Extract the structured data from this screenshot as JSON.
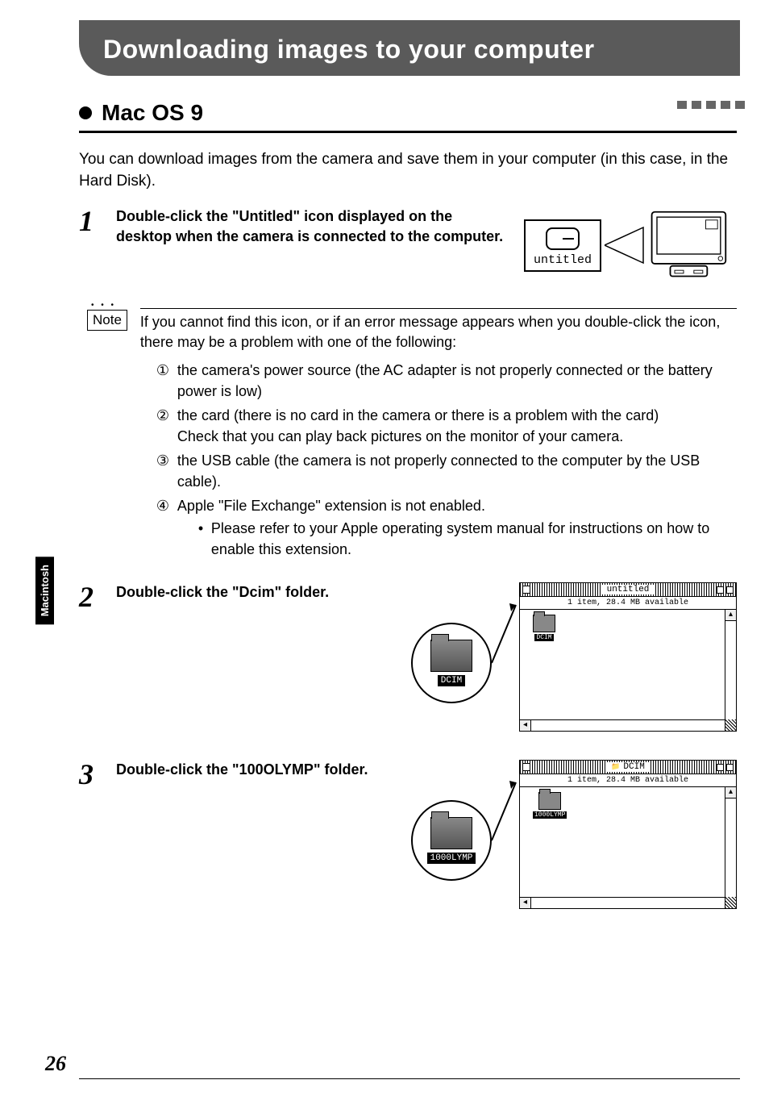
{
  "header": {
    "title": "Downloading images to your computer"
  },
  "section": {
    "title": "Mac OS 9"
  },
  "intro": "You can download images from the camera and save them in your computer (in this case, in the Hard Disk).",
  "steps": {
    "s1": {
      "num": "1",
      "text": "Double-click the \"Untitled\" icon displayed on the desktop when the camera is connected to the computer."
    },
    "s1_icon_label": "untitled",
    "s2": {
      "num": "2",
      "text": "Double-click the \"Dcim\" folder."
    },
    "s3": {
      "num": "3",
      "text": "Double-click the \"100OLYMP\" folder."
    }
  },
  "note": {
    "label": "Note",
    "lead": "If you cannot find this icon, or if an error message appears when you double-click the icon, there may be a problem with one of the following:",
    "items": {
      "i1": {
        "mark": "①",
        "text": "the camera's power source (the AC adapter is not properly connected or the battery power is low)"
      },
      "i2": {
        "mark": "②",
        "text": "the card (there is no card in the camera or there is a problem with the card)",
        "extra": "Check that you can play back pictures on the monitor of your camera."
      },
      "i3": {
        "mark": "③",
        "text": "the USB cable (the camera is not properly connected to the computer by the USB cable)."
      },
      "i4": {
        "mark": "④",
        "text": "Apple \"File Exchange\" extension is not enabled.",
        "sub": "Please refer to your Apple operating system manual for instructions on how to enable this extension."
      }
    }
  },
  "windows": {
    "w1": {
      "title": "untitled",
      "status": "1 item, 28.4 MB available",
      "folder": "DCIM"
    },
    "w2": {
      "title": "DCIM",
      "status": "1 item, 28.4 MB available",
      "folder": "1000LYMP"
    }
  },
  "big_folders": {
    "f1": "DCIM",
    "f2": "1000LYMP"
  },
  "side_tab": "Macintosh",
  "page_number": "26"
}
